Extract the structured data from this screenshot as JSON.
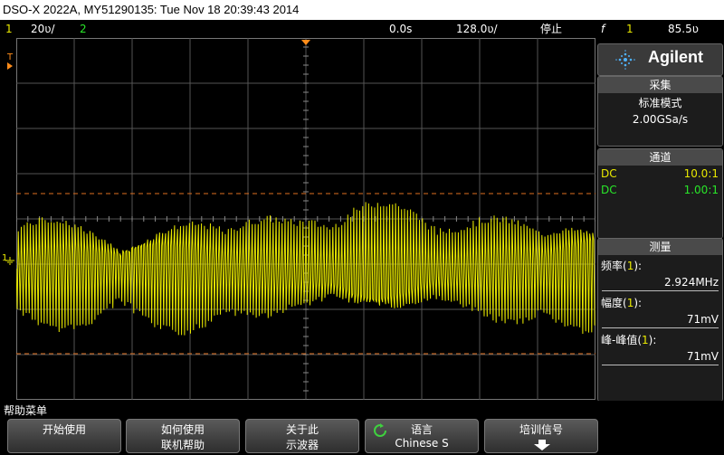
{
  "title_bar": "DSO-X 2022A, MY51290135: Tue Nov 18 20:39:43 2014",
  "status": {
    "ch1_num": "1",
    "ch1_scale": "20ʋ/",
    "ch2_num": "2",
    "time_delay": "0.0s",
    "time_scale": "128.0ʋ/",
    "run_state": "停止",
    "trigger_icon": "f",
    "trigger_src": "1",
    "trigger_level": "85.5ʋ"
  },
  "markers": {
    "trigger_marker": "T",
    "ground_marker": "1"
  },
  "panel": {
    "brand": "Agilent",
    "acquisition": {
      "header": "采集",
      "mode": "标准模式",
      "rate": "2.00GSa/s"
    },
    "channels": {
      "header": "通道",
      "rows": [
        {
          "coupling": "DC",
          "ratio": "10.0:1",
          "color": "#e8e800"
        },
        {
          "coupling": "DC",
          "ratio": "1.00:1",
          "color": "#29e629"
        }
      ]
    },
    "measure": {
      "header": "测量",
      "items": [
        {
          "label": "频率(1):",
          "label_main": "频率(",
          "label_ch": "1",
          "label_end": "):",
          "value": "2.924MHz"
        },
        {
          "label": "幅度(1):",
          "label_main": "幅度(",
          "label_ch": "1",
          "label_end": "):",
          "value": "71mV"
        },
        {
          "label": "峰-峰值(1):",
          "label_main": "峰-峰值(",
          "label_ch": "1",
          "label_end": "):",
          "value": "71mV"
        }
      ]
    }
  },
  "softkeys": {
    "menu_title": "帮助菜单",
    "keys": [
      {
        "line1": "开始使用",
        "line2": ""
      },
      {
        "line1": "如何使用",
        "line2": "联机帮助"
      },
      {
        "line1": "关于此",
        "line2": "示波器"
      },
      {
        "line1": "语言",
        "line2": "Chinese S"
      },
      {
        "line1": "培训信号",
        "line2": ""
      }
    ]
  },
  "colors": {
    "ch1": "#e8e800",
    "ch2": "#29e629",
    "cursor": "#e07020",
    "trigger": "#ff8c1a"
  }
}
